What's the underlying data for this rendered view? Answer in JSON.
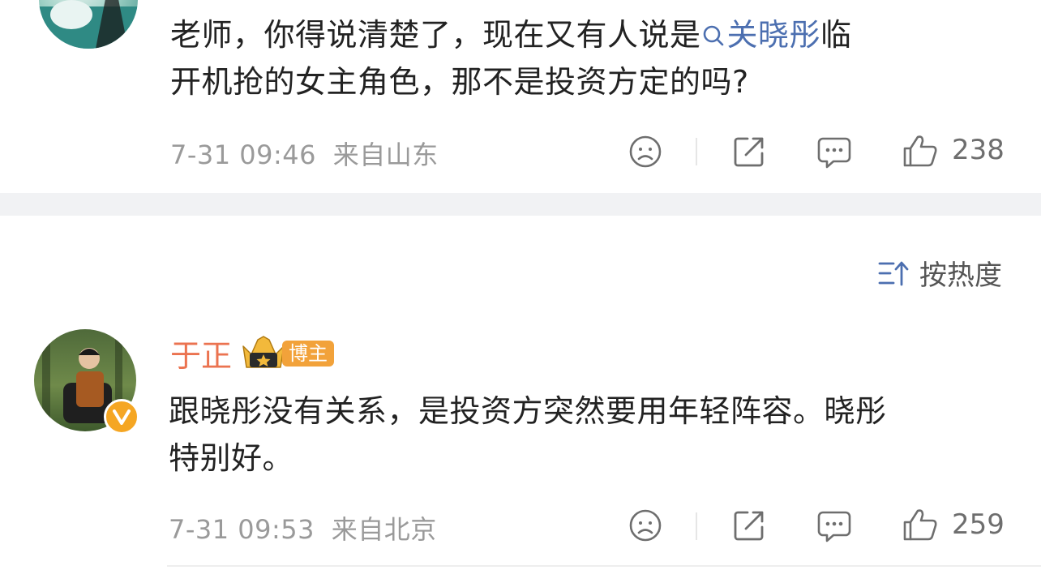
{
  "comment1": {
    "text_before": "老师，你得说清楚了，现在又有人说是",
    "topic": "关晓彤",
    "text_line1_end": "临",
    "text_line2": "开机抢的女主角色，那不是投资方定的吗?",
    "time": "7-31 09:46",
    "location": "来自山东",
    "like_count": "238"
  },
  "sort": {
    "label": "按热度"
  },
  "comment2": {
    "username": "于正",
    "badge": "博主",
    "avatar_verified": "V",
    "text_line1": "跟晓彤没有关系，是投资方突然要用年轻阵容。晓彤",
    "text_line2": "特别好。",
    "time": "7-31 09:53",
    "location": "来自北京",
    "like_count": "259"
  },
  "colors": {
    "username": "#eb7350",
    "topic_link": "#4c6fb0",
    "badge": "#f2a23a",
    "separator": "#f1f2f4"
  },
  "icons": [
    "search-icon",
    "sad-face-icon",
    "share-icon",
    "comment-icon",
    "thumbs-up-icon",
    "sort-icon",
    "crown-icon",
    "verified-v-icon"
  ]
}
